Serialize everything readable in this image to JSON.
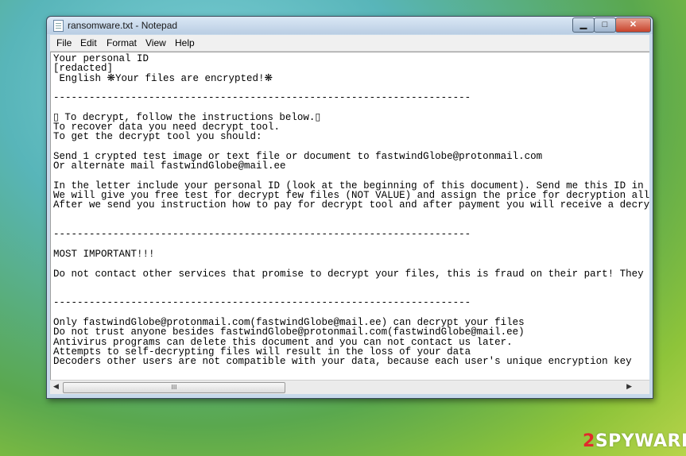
{
  "window": {
    "title": "ransomware.txt - Notepad",
    "minimize": "▁",
    "maximize": "□",
    "close": "✕"
  },
  "menu": [
    "File",
    "Edit",
    "Format",
    "View",
    "Help"
  ],
  "document": {
    "lines": [
      "Your personal ID",
      "[redacted]",
      " English ❋Your files are encrypted!❋",
      "",
      "----------------------------------------------------------------------",
      "",
      "▯ To decrypt, follow the instructions below.▯",
      "To recover data you need decrypt tool.",
      "To get the decrypt tool you should:",
      "",
      "Send 1 crypted test image or text file or document to fastwindGlobe@protonmail.com",
      "Or alternate mail fastwindGlobe@mail.ee",
      "",
      "In the letter include your personal ID (look at the beginning of this document). Send me this ID in your first email to me!",
      "We will give you free test for decrypt few files (NOT VALUE) and assign the price for decryption all files.",
      "After we send you instruction how to pay for decrypt tool and after payment you will receive a decryption tool!",
      "",
      "",
      "----------------------------------------------------------------------",
      "",
      "MOST IMPORTANT!!!",
      "",
      "Do not contact other services that promise to decrypt your files, this is fraud on their part! They will buy decoder from us",
      "",
      "",
      "----------------------------------------------------------------------",
      "",
      "Only fastwindGlobe@protonmail.com(fastwindGlobe@mail.ee) can decrypt your files",
      "Do not trust anyone besides fastwindGlobe@protonmail.com(fastwindGlobe@mail.ee)",
      "Antivirus programs can delete this document and you can not contact us later.",
      "Attempts to self-decrypting files will result in the loss of your data",
      "Decoders other users are not compatible with your data, because each user's unique encryption key"
    ]
  },
  "scrollbar": {
    "left_arrow": "◀",
    "right_arrow": "▶",
    "grip": "III"
  },
  "watermark": {
    "prefix": "2",
    "text": "SPYWARE"
  }
}
